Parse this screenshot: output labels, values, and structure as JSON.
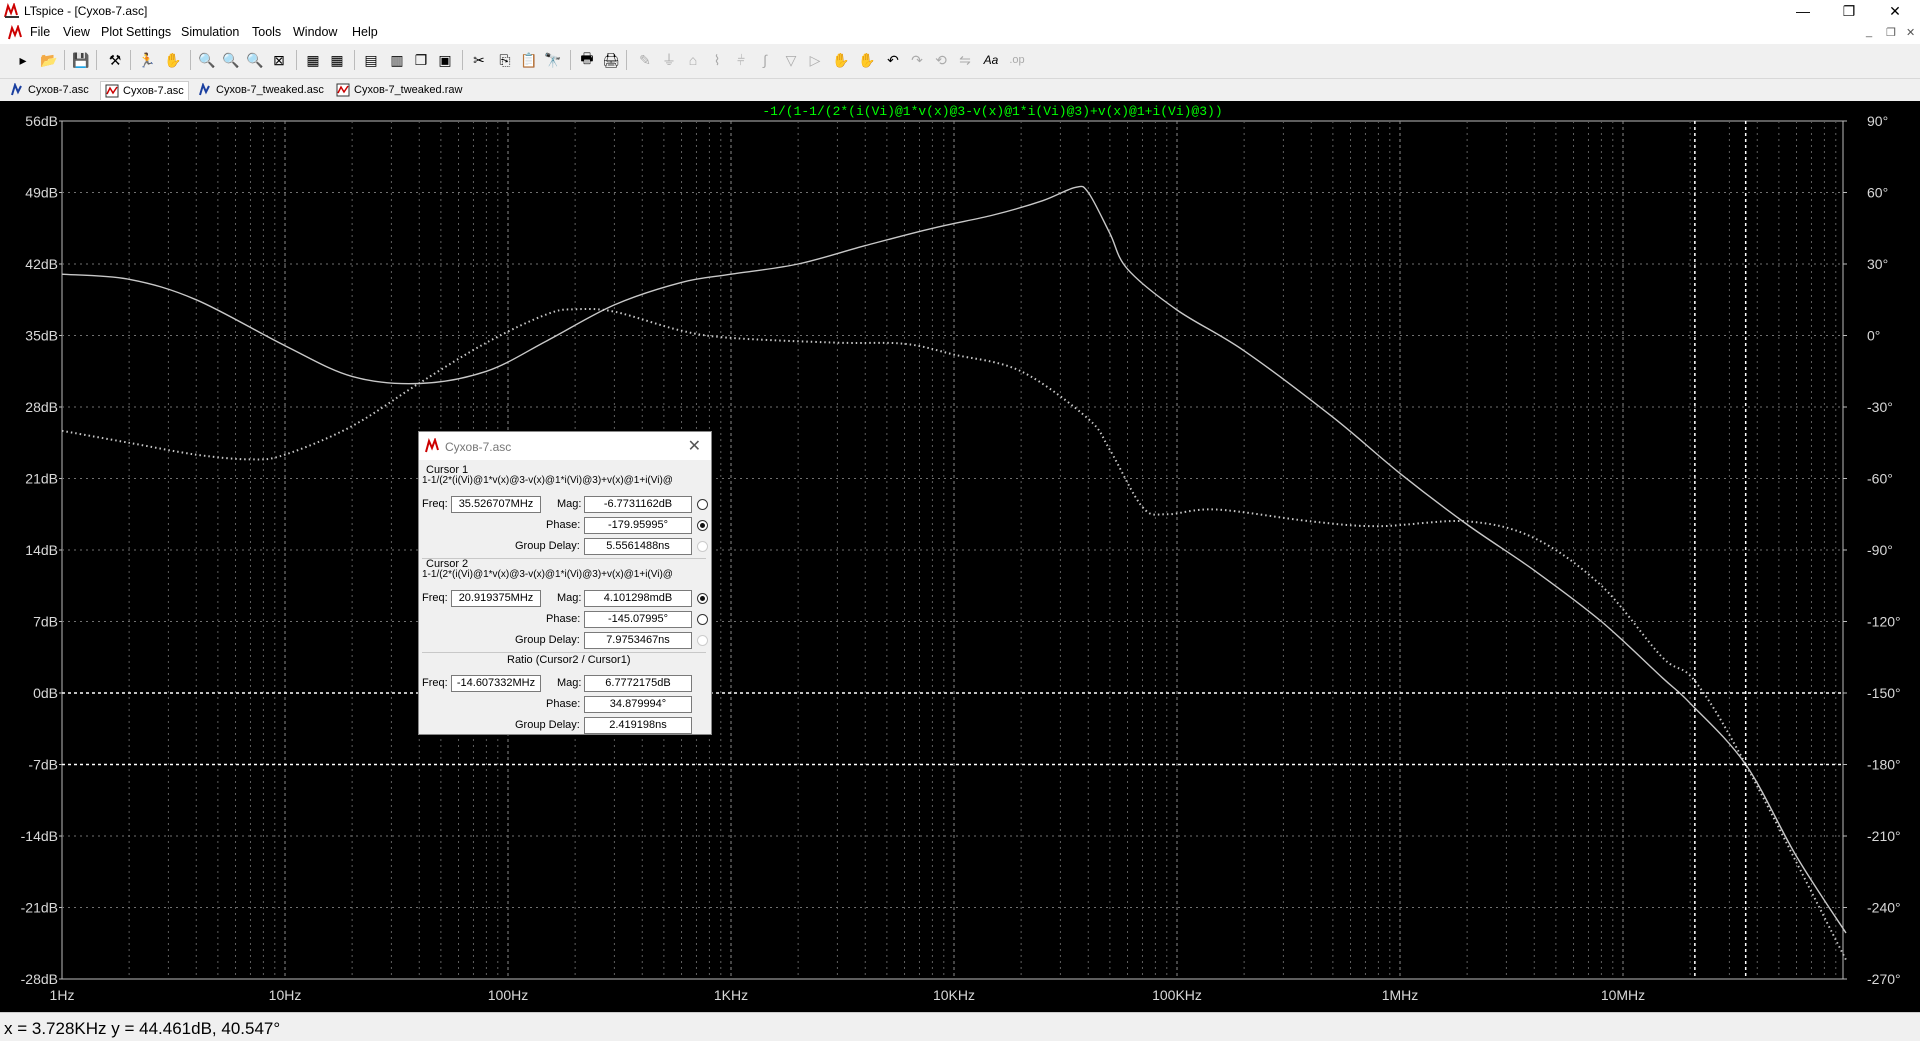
{
  "window": {
    "title": "LTspice - [Сухов-7.asc]"
  },
  "menu": [
    "File",
    "View",
    "Plot Settings",
    "Simulation",
    "Tools",
    "Window",
    "Help"
  ],
  "tabs": [
    {
      "label": "Сухов-7.asc",
      "icon": "schematic-icon",
      "active": false
    },
    {
      "label": "Сухов-7.asc",
      "icon": "waveform-icon",
      "active": true
    },
    {
      "label": "Сухов-7_tweaked.asc",
      "icon": "schematic-icon",
      "active": false
    },
    {
      "label": "Сухов-7_tweaked.raw",
      "icon": "waveform-icon",
      "active": false
    }
  ],
  "plot": {
    "trace_expression": "-1/(1-1/(2*(i(Vi)@1*v(x)@3-v(x)@1*i(Vi)@3)+v(x)@1+i(Vi)@3))",
    "trace_color": "#00ff00"
  },
  "chart_data": {
    "type": "line",
    "x_scale": "log",
    "x_ticks": [
      "1Hz",
      "10Hz",
      "100Hz",
      "1KHz",
      "10KHz",
      "100KHz",
      "1MHz",
      "10MHz"
    ],
    "x_range_hz": [
      1,
      100000000
    ],
    "y_left_ticks": [
      "56dB",
      "49dB",
      "42dB",
      "35dB",
      "28dB",
      "21dB",
      "14dB",
      "7dB",
      "0dB",
      "-7dB",
      "-14dB",
      "-21dB",
      "-28dB"
    ],
    "y_left_range_db": [
      -28,
      56
    ],
    "y_right_ticks": [
      "90°",
      "60°",
      "30°",
      "0°",
      "-30°",
      "-60°",
      "-90°",
      "-120°",
      "-150°",
      "-180°",
      "-210°",
      "-240°",
      "-270°"
    ],
    "y_right_range_deg": [
      -270,
      90
    ],
    "grid": true,
    "series": [
      {
        "style": "solid",
        "axis": "left",
        "points": [
          [
            1,
            41
          ],
          [
            2,
            40.5
          ],
          [
            4,
            38.5
          ],
          [
            10,
            34
          ],
          [
            20,
            31
          ],
          [
            40,
            30.3
          ],
          [
            80,
            31.5
          ],
          [
            150,
            34.5
          ],
          [
            300,
            38
          ],
          [
            600,
            40.2
          ],
          [
            1000,
            41
          ],
          [
            2000,
            42
          ],
          [
            4000,
            43.8
          ],
          [
            8000,
            45.5
          ],
          [
            15000,
            46.8
          ],
          [
            25000,
            48.2
          ],
          [
            35000,
            49.5
          ],
          [
            40000,
            49
          ],
          [
            50000,
            45
          ],
          [
            60000,
            41.5
          ],
          [
            100000,
            37.5
          ],
          [
            200000,
            33.5
          ],
          [
            500000,
            27
          ],
          [
            1000000,
            21.5
          ],
          [
            2000000,
            16.5
          ],
          [
            4000000,
            12
          ],
          [
            8000000,
            7
          ],
          [
            15000000,
            1.5
          ],
          [
            20000000,
            -1
          ],
          [
            35500000,
            -7
          ],
          [
            60000000,
            -16
          ],
          [
            100000000,
            -23.5
          ]
        ]
      },
      {
        "style": "dotted",
        "axis": "right",
        "points": [
          [
            1,
            -40
          ],
          [
            2,
            -45
          ],
          [
            4,
            -50
          ],
          [
            7,
            -52
          ],
          [
            10,
            -50
          ],
          [
            20,
            -38
          ],
          [
            40,
            -20
          ],
          [
            80,
            -3
          ],
          [
            150,
            9
          ],
          [
            200,
            11
          ],
          [
            300,
            10
          ],
          [
            600,
            2
          ],
          [
            1000,
            -1
          ],
          [
            3000,
            -3
          ],
          [
            6000,
            -3.5
          ],
          [
            10000,
            -8
          ],
          [
            20000,
            -15
          ],
          [
            40000,
            -35
          ],
          [
            50000,
            -48
          ],
          [
            70000,
            -72
          ],
          [
            90000,
            -75
          ],
          [
            150000,
            -73
          ],
          [
            400000,
            -78
          ],
          [
            800000,
            -80
          ],
          [
            2000000,
            -78
          ],
          [
            4000000,
            -85
          ],
          [
            8000000,
            -105
          ],
          [
            15000000,
            -135
          ],
          [
            21000000,
            -145
          ],
          [
            35500000,
            -180
          ],
          [
            100000000,
            -262
          ]
        ]
      }
    ],
    "cursors": [
      {
        "freq_hz": 21000000,
        "level_db": 0
      },
      {
        "freq_hz": 35500000,
        "level_db": -7
      }
    ]
  },
  "cursor_dialog": {
    "title": "Сухов-7.asc",
    "cursor1": {
      "heading": "Cursor 1",
      "expression": "1-1/(2*(i(Vi)@1*v(x)@3-v(x)@1*i(Vi)@3)+v(x)@1+i(Vi)@",
      "freq_label": "Freq:",
      "freq": "35.526707MHz",
      "mag_label": "Mag:",
      "mag": "-6.7731162dB",
      "phase_label": "Phase:",
      "phase": "-179.95995°",
      "gd_label": "Group Delay:",
      "gd": "5.5561488ns"
    },
    "cursor2": {
      "heading": "Cursor 2",
      "expression": "1-1/(2*(i(Vi)@1*v(x)@3-v(x)@1*i(Vi)@3)+v(x)@1+i(Vi)@",
      "freq_label": "Freq:",
      "freq": "20.919375MHz",
      "mag_label": "Mag:",
      "mag": "4.101298mdB",
      "phase_label": "Phase:",
      "phase": "-145.07995°",
      "gd_label": "Group Delay:",
      "gd": "7.9753467ns"
    },
    "ratio": {
      "heading": "Ratio (Cursor2 / Cursor1)",
      "freq_label": "Freq:",
      "freq": "-14.607332MHz",
      "mag_label": "Mag:",
      "mag": "6.7772175dB",
      "phase_label": "Phase:",
      "phase": "34.879994°",
      "gd_label": "Group Delay:",
      "gd": "2.419198ns"
    }
  },
  "status": {
    "text": "x = 3.728KHz    y = 44.461dB, 40.547°"
  },
  "window_controls": {
    "minimize": "—",
    "maximize": "❐",
    "close": "✕"
  }
}
